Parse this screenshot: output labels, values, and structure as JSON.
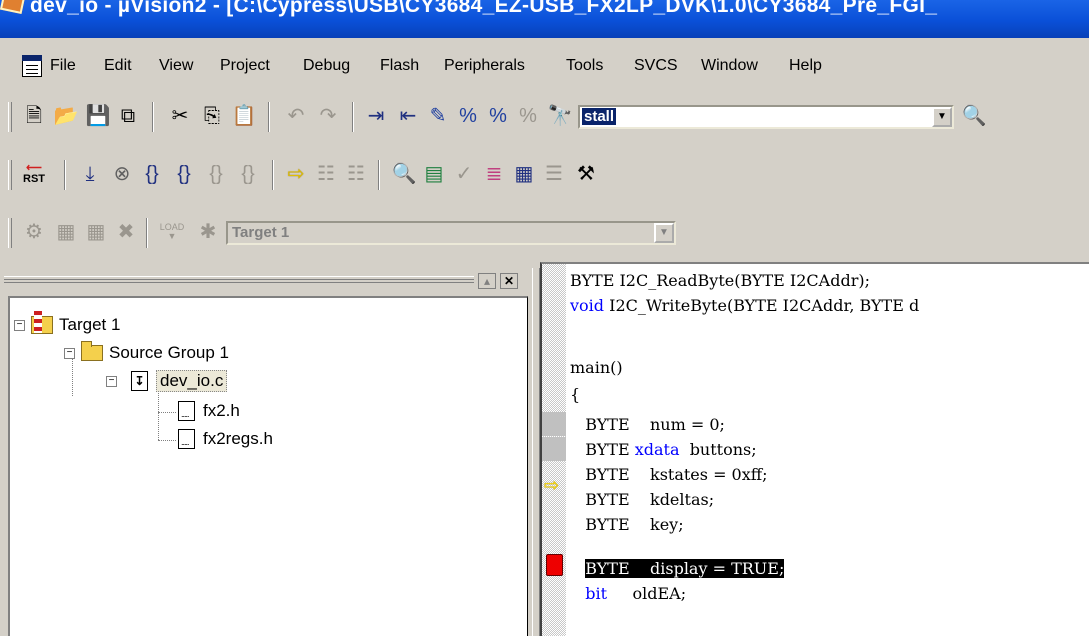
{
  "window": {
    "title": "dev_io  - µVision2 - [C:\\Cypress\\USB\\CY3684_EZ-USB_FX2LP_DVK\\1.0\\CY3684_Pre_FGI_"
  },
  "menubar": {
    "items": [
      "File",
      "Edit",
      "View",
      "Project",
      "Debug",
      "Flash",
      "Peripherals",
      "Tools",
      "SVCS",
      "Window",
      "Help"
    ]
  },
  "toolbar1": {
    "search_value": "stall"
  },
  "toolbar2": {
    "rst_label": "RST"
  },
  "toolbar3": {
    "load_label": "LOAD",
    "target_value": "Target 1"
  },
  "project_tree": {
    "target": "Target 1",
    "group": "Source Group 1",
    "file": "dev_io.c",
    "includes": [
      "fx2.h",
      "fx2regs.h"
    ]
  },
  "editor": {
    "lines": [
      {
        "type": "BYTE",
        "rest": " I2C_ReadByte(BYTE I2CAddr);"
      },
      {
        "type": "void",
        "rest": " I2C_WriteByte(BYTE I2CAddr, BYTE d"
      },
      {
        "type": "",
        "rest": ""
      },
      {
        "type": "",
        "rest": "main()"
      },
      {
        "type": "",
        "rest": "{"
      },
      {
        "type": "",
        "rest": "   BYTE    num = 0;"
      },
      {
        "type": "",
        "rest": "   BYTE xdata  buttons;"
      },
      {
        "type": "",
        "rest": "   BYTE    kstates = 0xff;"
      },
      {
        "type": "",
        "rest": "   BYTE    kdeltas;"
      },
      {
        "type": "",
        "rest": "   BYTE    key;"
      },
      {
        "type": "",
        "rest": "   BYTE    display = TRUE;"
      },
      {
        "type": "",
        "rest": "   bit     oldEA;"
      }
    ],
    "xdata_kw": "xdata",
    "bit_kw": "bit"
  }
}
